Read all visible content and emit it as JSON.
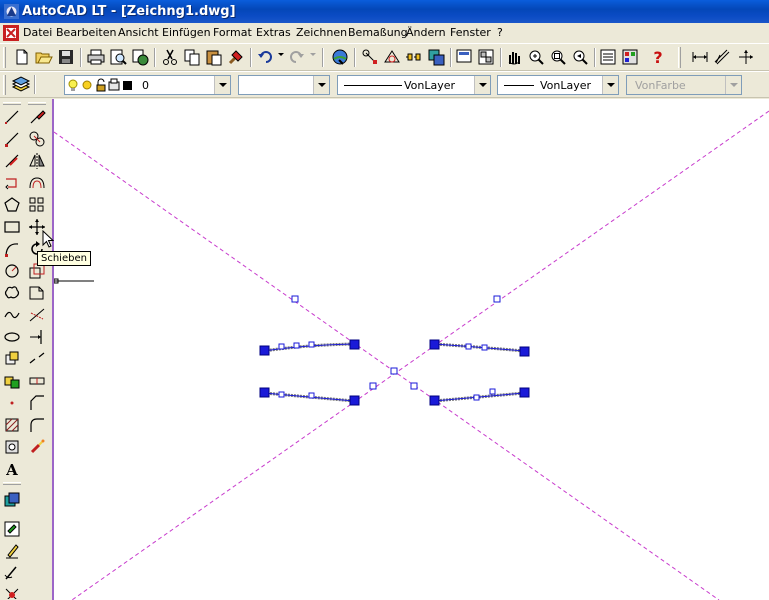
{
  "window": {
    "title": "AutoCAD LT - [Zeichng1.dwg]"
  },
  "menu": {
    "items": [
      "Datei",
      "Bearbeiten",
      "Ansicht",
      "Einfügen",
      "Format",
      "Extras",
      "Zeichnen",
      "Bemaßung",
      "Ändern",
      "Fenster",
      "?"
    ]
  },
  "properties_bar": {
    "layer_value": "0",
    "linetype_value": "VonLayer",
    "lineweight_value": "VonLayer",
    "color_value": "VonFarbe"
  },
  "tooltip": {
    "text": "Schieben"
  },
  "icons": {
    "standard_toolbar": [
      "new-icon",
      "open-icon",
      "save-icon",
      "print-icon",
      "print-preview-icon",
      "publish-icon",
      "spellcheck-icon",
      "cut-icon",
      "copy-icon",
      "paste-icon",
      "match-properties-icon",
      "undo-icon",
      "redo-icon",
      "hyperlink-icon",
      "snap-from-icon",
      "osnap-icon",
      "tracking-icon",
      "ucs-icon",
      "named-views-icon",
      "realtime-pan-icon",
      "realtime-zoom-icon",
      "zoom-window-icon",
      "zoom-previous-icon",
      "properties-icon",
      "design-center-icon",
      "help-icon",
      "dimension-linear-icon",
      "dimension-aligned-icon",
      "dimension-ordinate-icon"
    ],
    "draw_toolbar": [
      "line-icon",
      "ray-icon",
      "construction-line-icon",
      "polyline-icon",
      "polygon-icon",
      "rectangle-icon",
      "arc-icon",
      "circle-icon",
      "revision-cloud-icon",
      "spline-icon",
      "ellipse-icon",
      "insert-block-icon",
      "make-block-icon",
      "point-icon",
      "hatch-icon",
      "region-icon",
      "text-icon"
    ],
    "modify_toolbar": [
      "erase-icon",
      "copy-object-icon",
      "mirror-icon",
      "offset-icon",
      "array-icon",
      "move-icon",
      "rotate-icon",
      "scale-icon",
      "stretch-icon",
      "trim-icon",
      "extend-icon",
      "break-icon",
      "join-icon",
      "chamfer-icon",
      "fillet-icon",
      "explode-icon"
    ],
    "extra_toolbar": [
      "layer-icon",
      "properties-small-icon",
      "edit-icon",
      "pen-icon",
      "palette-icon"
    ]
  },
  "colors": {
    "titlebar": "#0a5ddc",
    "crosshair_lines": "#c83ccd",
    "grips": "#1a1ad8",
    "canvas": "#ffffff"
  }
}
